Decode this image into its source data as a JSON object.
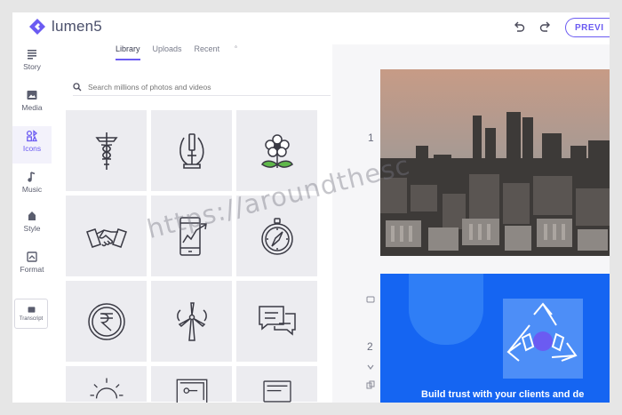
{
  "app": {
    "logo_text": "lumen5"
  },
  "toolbar": {
    "preview_label": "PREVI"
  },
  "rail": {
    "items": [
      {
        "label": "Story",
        "icon": "story-icon"
      },
      {
        "label": "Media",
        "icon": "media-icon"
      },
      {
        "label": "Icons",
        "icon": "icons-icon",
        "active": true
      },
      {
        "label": "Music",
        "icon": "music-icon"
      },
      {
        "label": "Style",
        "icon": "style-icon"
      },
      {
        "label": "Format",
        "icon": "format-icon"
      }
    ],
    "transcript_label": "Transcript"
  },
  "library": {
    "tabs": [
      {
        "label": "Library",
        "active": true
      },
      {
        "label": "Uploads"
      },
      {
        "label": "Recent"
      }
    ],
    "search_placeholder": "Search millions of photos and videos",
    "icons": [
      "caduceus-icon",
      "microscope-icon",
      "flower-icon",
      "handshake-icon",
      "phone-chart-icon",
      "compass-icon",
      "rupee-icon",
      "wind-turbine-icon",
      "chat-bubbles-icon",
      "sun-icon",
      "blueprint-icon",
      "presentation-icon"
    ]
  },
  "scenes": {
    "scene1_number": "1",
    "scene2_number": "2",
    "scene2_caption": "Build trust with your clients and de"
  },
  "watermark": "https://aroundthesc",
  "colors": {
    "accent": "#6b5bf2",
    "scene_blue": "#1565f2"
  }
}
